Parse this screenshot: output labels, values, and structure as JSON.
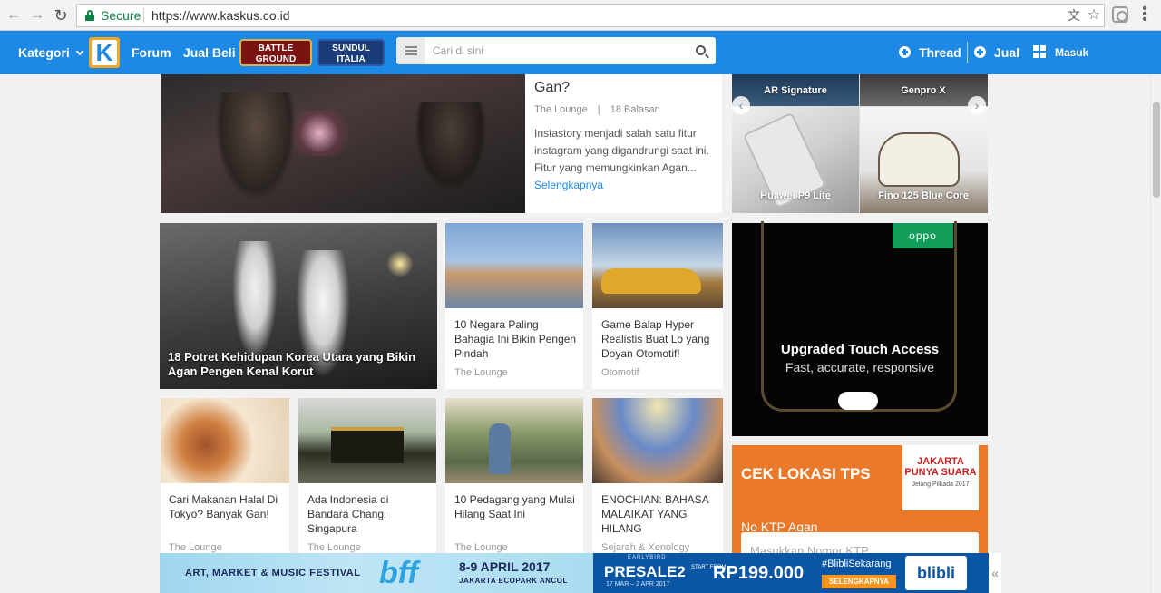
{
  "browser": {
    "secure_label": "Secure",
    "url": "https://www.kaskus.co.id"
  },
  "header": {
    "kategori": "Kategori",
    "forum": "Forum",
    "jual_beli": "Jual Beli",
    "badge_battle": "BATTLE GROUND",
    "badge_sundul": "SUNDUL ITALIA",
    "search_placeholder": "Cari di sini",
    "thread": "Thread",
    "jual": "Jual",
    "masuk": "Masuk"
  },
  "featured": {
    "title": "Gan?",
    "category": "The Lounge",
    "replies": "18 Balasan",
    "excerpt": "Instastory menjadi salah satu fitur instagram yang digandrungi saat ini. Fitur yang memungkinkan Agan...",
    "link": "Selengkapnya"
  },
  "big_card": {
    "title": "18 Potret Kehidupan Korea Utara yang Bikin Agan Pengen Kenal Korut"
  },
  "cards": [
    {
      "title": "10 Negara Paling Bahagia Ini Bikin Pengen Pindah",
      "category": "The Lounge"
    },
    {
      "title": "Game Balap Hyper Realistis Buat Lo yang Doyan Otomotif!",
      "category": "Otomotif"
    },
    {
      "title": "Cari Makanan Halal Di Tokyo? Banyak Gan!",
      "category": "The Lounge"
    },
    {
      "title": "Ada Indonesia di Bandara Changi Singapura",
      "category": "The Lounge"
    },
    {
      "title": "10 Pedagang yang Mulai Hilang Saat Ini",
      "category": "The Lounge"
    },
    {
      "title": "ENOCHIAN: BAHASA MALAIKAT YANG HILANG",
      "category": "Sejarah & Xenology"
    }
  ],
  "products": [
    "AR Signature",
    "Genpro X",
    "Huawei P9 Lite",
    "Fino 125 Blue Core"
  ],
  "ad_oppo": {
    "brand": "oppo",
    "headline": "Upgraded Touch Access",
    "subline": "Fast, accurate, responsive"
  },
  "ad_tps": {
    "title": "CEK LOKASI TPS",
    "label": "No KTP Agan",
    "input_placeholder": "Masukkan Nomor KTP",
    "logo_text": "JAKARTA PUNYA SUARA",
    "logo_sub": "Jelang Pilkada 2017"
  },
  "banner": {
    "festival": "ART, MARKET & MUSIC FESTIVAL",
    "bff": "bff",
    "date": "8-9 APRIL 2017",
    "venue": "JAKARTA ECOPARK ANCOL",
    "earlybird": "EARLYBIRD",
    "presale": "PRESALE2",
    "presale_dates": "17 MAR – 2 APR 2017",
    "start_from": "START FROM",
    "price": "RP199.000",
    "hashtag": "#BlibliSekarang",
    "cta": "SELENGKAPNYA",
    "blibli": "blibli"
  },
  "colors": {
    "header": "#1e88e5",
    "tps": "#ea7a2a",
    "oppo": "#0f9d58"
  }
}
